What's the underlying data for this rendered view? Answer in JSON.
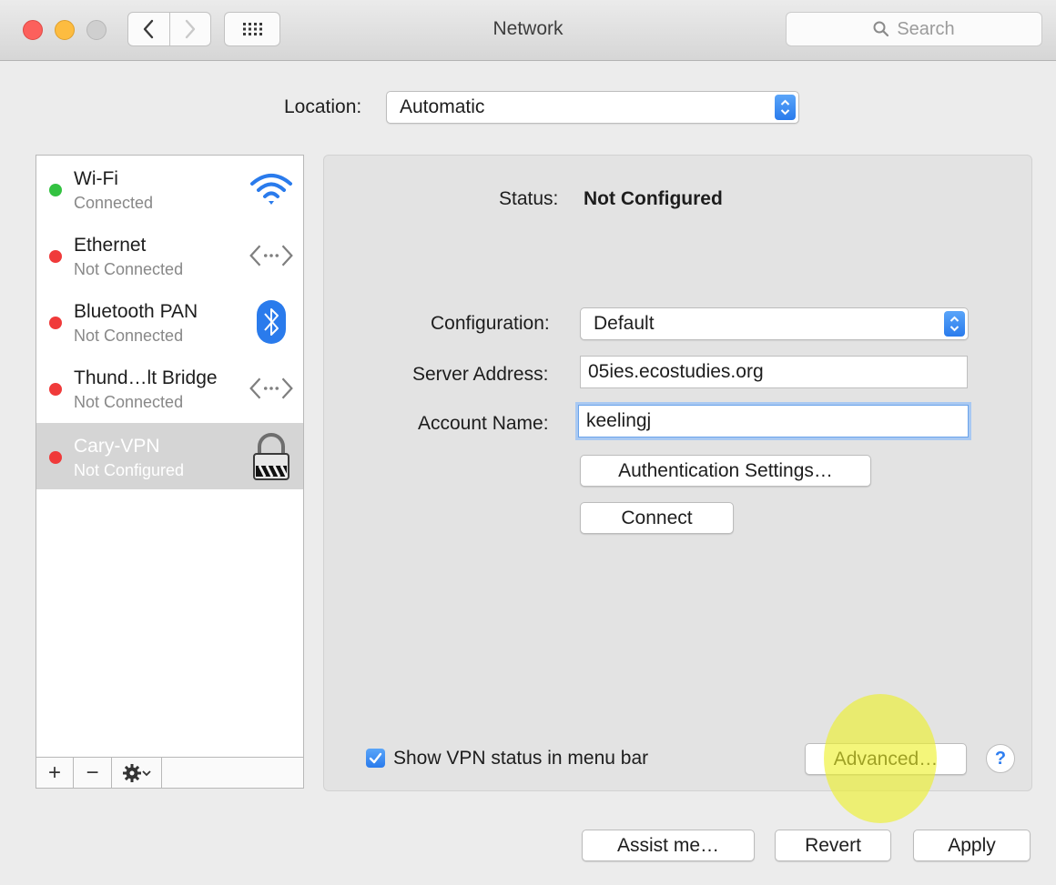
{
  "window": {
    "title": "Network"
  },
  "toolbar": {
    "search_placeholder": "Search"
  },
  "location": {
    "label": "Location:",
    "value": "Automatic"
  },
  "services": [
    {
      "name": "Wi-Fi",
      "status": "Connected",
      "status_color": "#33c241",
      "icon": "wifi-icon"
    },
    {
      "name": "Ethernet",
      "status": "Not Connected",
      "status_color": "#f03a3a",
      "icon": "ethernet-icon"
    },
    {
      "name": "Bluetooth PAN",
      "status": "Not Connected",
      "status_color": "#f03a3a",
      "icon": "bluetooth-icon"
    },
    {
      "name": "Thund…lt Bridge",
      "status": "Not Connected",
      "status_color": "#f03a3a",
      "icon": "ethernet-icon"
    },
    {
      "name": "Cary-VPN",
      "status": "Not Configured",
      "status_color": "#f03a3a",
      "icon": "lock-icon",
      "selected": true
    }
  ],
  "sidebar_footer": {
    "add": "+",
    "remove": "−"
  },
  "detail": {
    "status_label": "Status:",
    "status_value": "Not Configured",
    "configuration_label": "Configuration:",
    "configuration_value": "Default",
    "server_label": "Server Address:",
    "server_value": "05ies.ecostudies.org",
    "account_label": "Account Name:",
    "account_value": "keelingj",
    "auth_button": "Authentication Settings…",
    "connect_button": "Connect",
    "show_vpn_label": "Show VPN status in menu bar",
    "show_vpn_checked": true,
    "advanced_button": "Advanced…",
    "help": "?"
  },
  "bottom": {
    "assist": "Assist me…",
    "revert": "Revert",
    "apply": "Apply"
  },
  "colors": {
    "accent": "#2a7bec",
    "selection": "#d5d5d5"
  }
}
